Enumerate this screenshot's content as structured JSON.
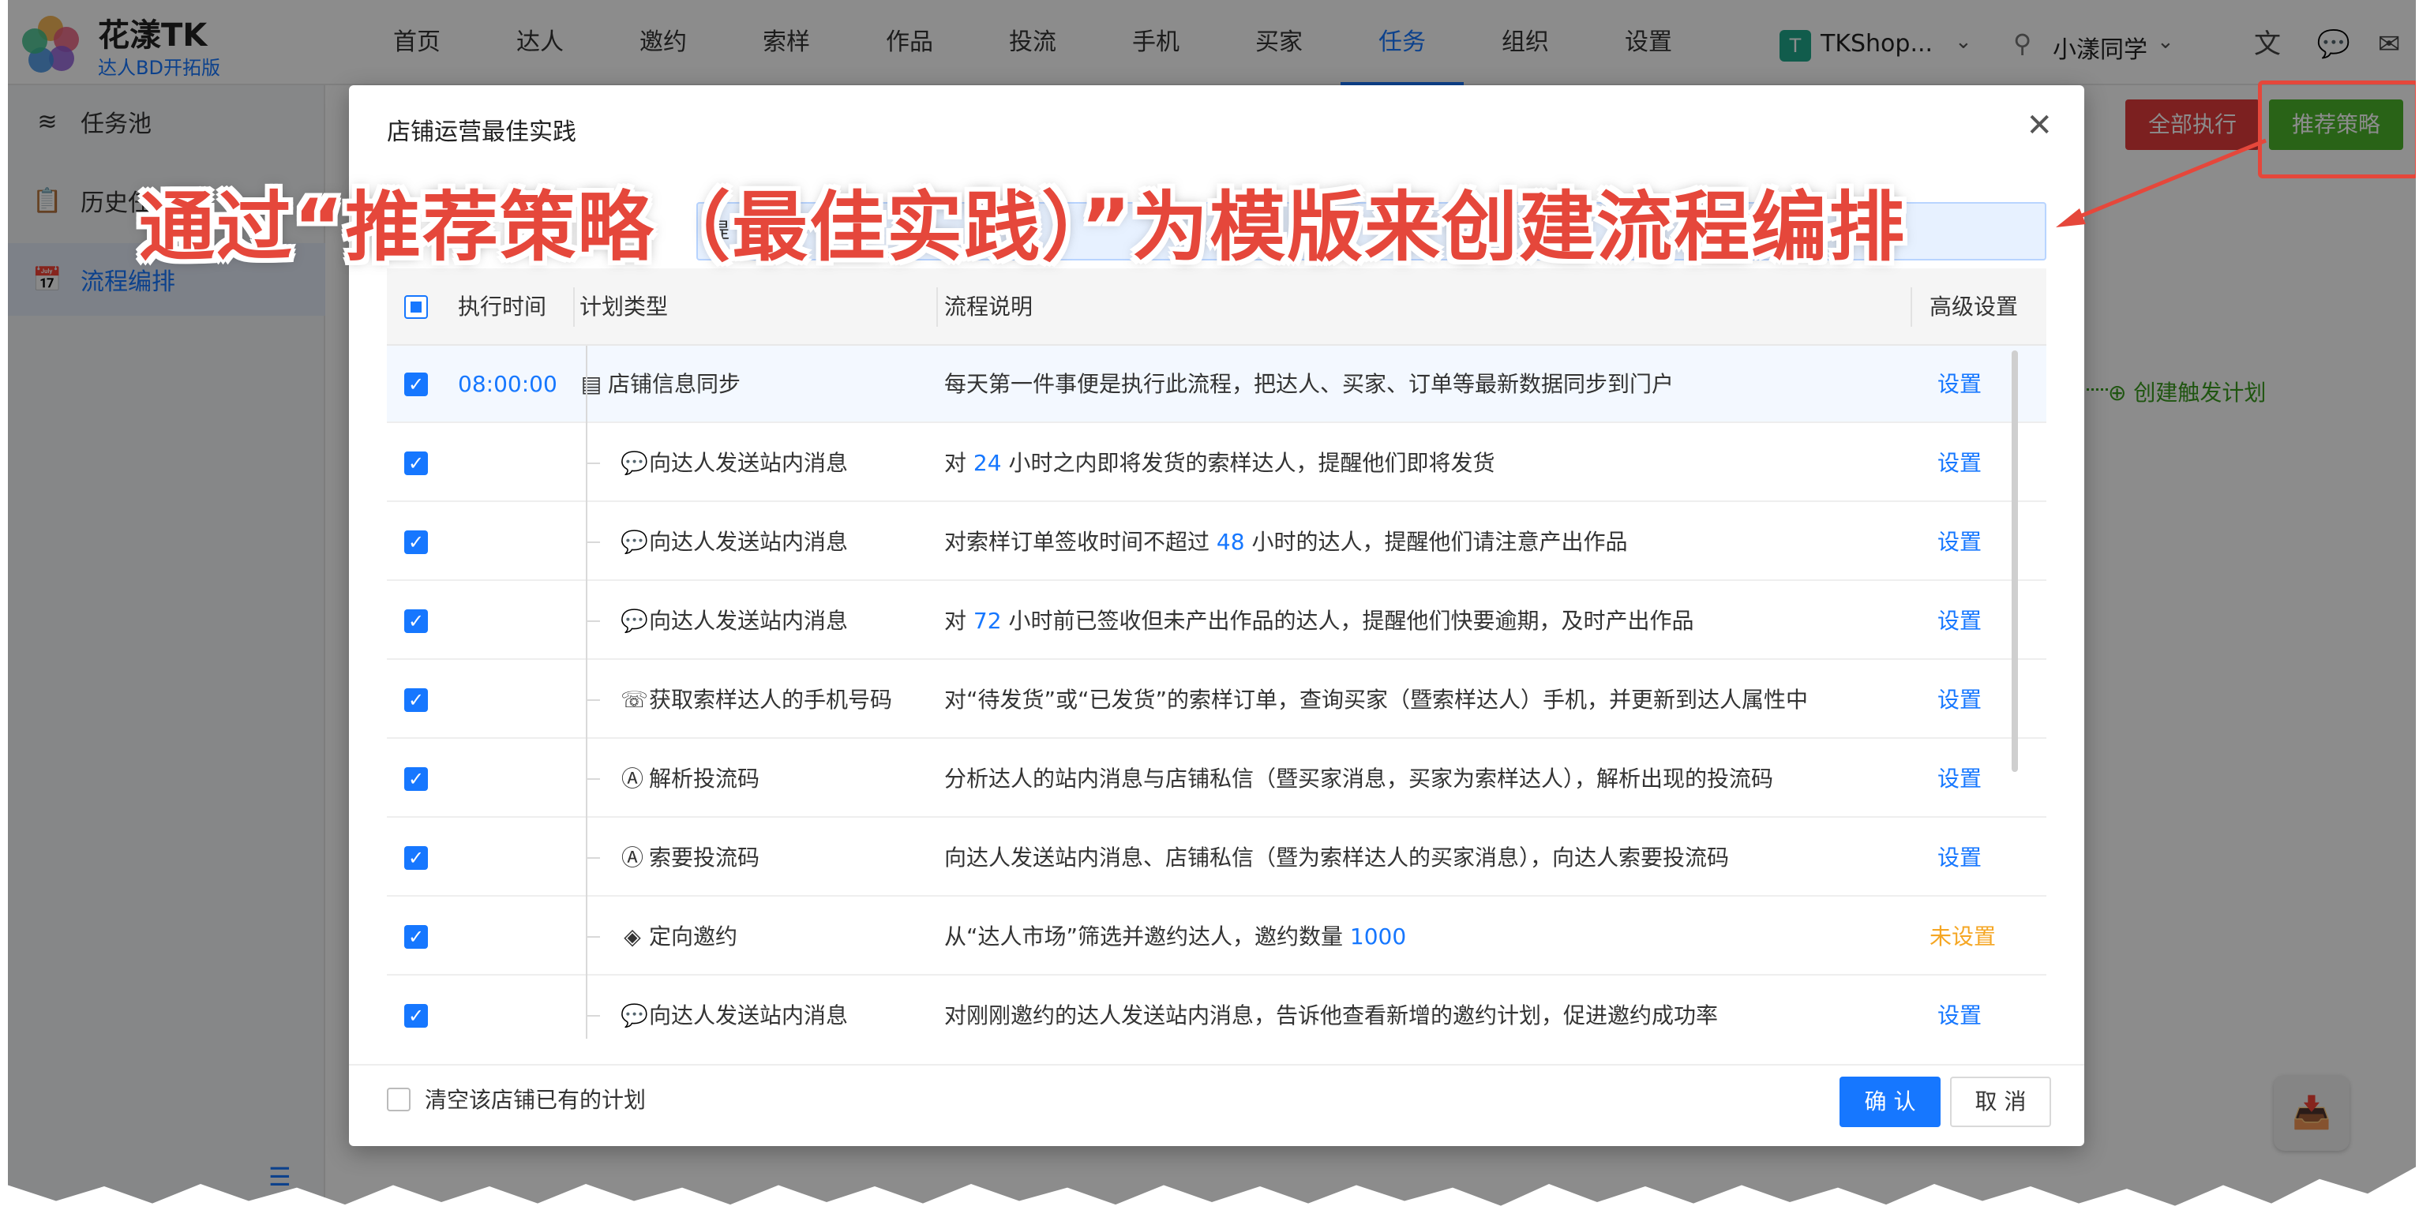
{
  "app": {
    "name": "花漾TK",
    "subtitle": "达人BD开拓版",
    "logo": "flower-logo"
  },
  "nav": {
    "items": [
      "首页",
      "达人",
      "邀约",
      "索样",
      "作品",
      "投流",
      "手机",
      "买家",
      "任务",
      "组织",
      "设置"
    ],
    "active": "任务"
  },
  "header": {
    "shop_chip": "T",
    "shop_name": "TKShop...",
    "user_name": "小漾同学",
    "icons": [
      "translate-icon",
      "chat-icon",
      "mail-icon",
      "help-icon"
    ]
  },
  "sidebar": {
    "items": [
      {
        "label": "任务池",
        "icon": "layers-icon"
      },
      {
        "label": "历史任",
        "icon": "clipboard-icon"
      },
      {
        "label": "流程编排",
        "icon": "calendar-icon"
      }
    ],
    "active": "流程编排"
  },
  "page": {
    "run_all_label": "全部执行",
    "recommend_label": "推荐策略",
    "create_trigger_label": "创建触发计划"
  },
  "modal": {
    "title": "店铺运营最佳实践",
    "hint_prefix": "提",
    "columns": {
      "time": "执行时间",
      "type": "计划类型",
      "desc": "流程说明",
      "settings": "高级设置"
    },
    "rows": [
      {
        "checked": true,
        "time": "08:00:00",
        "type": "店铺信息同步",
        "icon": "document-icon",
        "desc": [
          {
            "t": "每天第一件事便是执行此流程，把达人、买家、订单等最新数据同步到门户"
          }
        ],
        "setting": "设置"
      },
      {
        "checked": true,
        "time": "",
        "type": "向达人发送站内消息",
        "icon": "message-icon",
        "desc": [
          {
            "t": "对 "
          },
          {
            "t": "24",
            "hl": true
          },
          {
            "t": " 小时之内即将发货的索样达人，提醒他们即将发货"
          }
        ],
        "setting": "设置"
      },
      {
        "checked": true,
        "time": "",
        "type": "向达人发送站内消息",
        "icon": "message-icon",
        "desc": [
          {
            "t": "对索样订单签收时间不超过 "
          },
          {
            "t": "48",
            "hl": true
          },
          {
            "t": " 小时的达人，提醒他们请注意产出作品"
          }
        ],
        "setting": "设置"
      },
      {
        "checked": true,
        "time": "",
        "type": "向达人发送站内消息",
        "icon": "message-icon",
        "desc": [
          {
            "t": "对 "
          },
          {
            "t": "72",
            "hl": true
          },
          {
            "t": " 小时前已签收但未产出作品的达人，提醒他们快要逾期，及时产出作品"
          }
        ],
        "setting": "设置"
      },
      {
        "checked": true,
        "time": "",
        "type": "获取索样达人的手机号码",
        "icon": "contact-card-icon",
        "desc": [
          {
            "t": "对“待发货”或“已发货”的索样订单，查询买家（暨索样达人）手机，并更新到达人属性中"
          }
        ],
        "setting": "设置"
      },
      {
        "checked": true,
        "time": "",
        "type": "解析投流码",
        "icon": "ad-code-icon",
        "desc": [
          {
            "t": "分析达人的站内消息与店铺私信（暨买家消息，买家为索样达人），解析出现的投流码"
          }
        ],
        "setting": "设置"
      },
      {
        "checked": true,
        "time": "",
        "type": "索要投流码",
        "icon": "ad-code-icon",
        "desc": [
          {
            "t": "向达人发送站内消息、店铺私信（暨为索样达人的买家消息），向达人索要投流码"
          }
        ],
        "setting": "设置"
      },
      {
        "checked": true,
        "time": "",
        "type": "定向邀约",
        "icon": "tag-icon",
        "desc": [
          {
            "t": "从“达人市场”筛选并邀约达人，邀约数量 "
          },
          {
            "t": "1000",
            "hl": true
          }
        ],
        "setting": "未设置",
        "warn": true
      },
      {
        "checked": true,
        "time": "",
        "type": "向达人发送站内消息",
        "icon": "message-icon",
        "desc": [
          {
            "t": "对刚刚邀约的达人发送站内消息，告诉他查看新增的邀约计划，促进邀约成功率"
          }
        ],
        "setting": "设置"
      }
    ],
    "clear_label": "清空该店铺已有的计划",
    "ok_label": "确 认",
    "cancel_label": "取 消"
  },
  "annotation": {
    "text": "通过“推荐策略（最佳实践）”为模版来创建流程编排",
    "color": "#e5473b"
  },
  "colors": {
    "primary": "#1677ff",
    "danger": "#e23b3b",
    "success": "#4cb52b",
    "warning": "#f5a623"
  }
}
